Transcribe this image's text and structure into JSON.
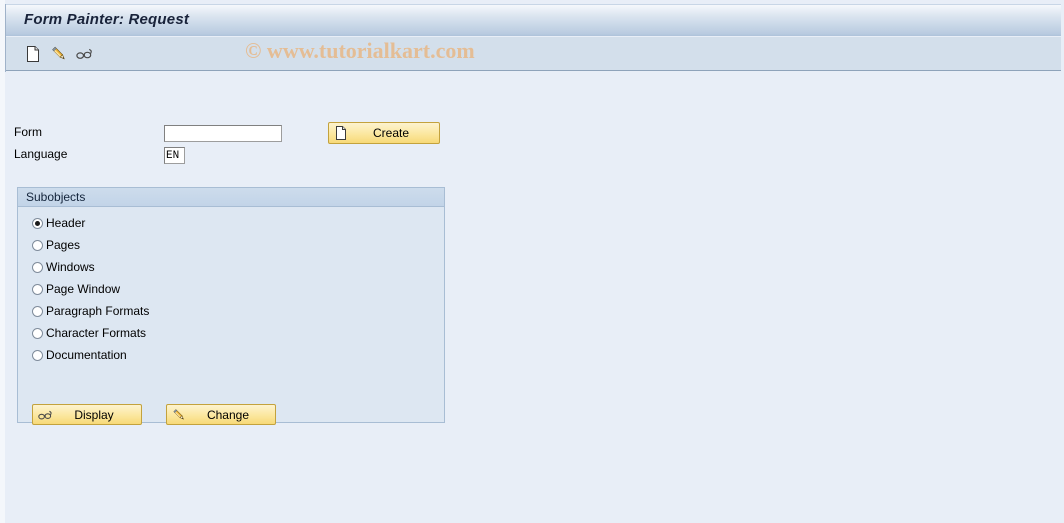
{
  "window": {
    "title": "Form Painter: Request"
  },
  "watermark": {
    "text": "© www.tutorialkart.com"
  },
  "toolbar": {
    "icons": [
      {
        "name": "create-icon",
        "glyph": "document"
      },
      {
        "name": "change-icon",
        "glyph": "pencil"
      },
      {
        "name": "display-icon",
        "glyph": "glasses"
      }
    ]
  },
  "selection": {
    "form": {
      "label": "Form",
      "value": "",
      "placeholder": ""
    },
    "language": {
      "label": "Language",
      "value": "EN",
      "placeholder": ""
    },
    "create_button": {
      "label": "Create",
      "icon": "document-icon"
    }
  },
  "subobjects": {
    "title": "Subobjects",
    "selected": "Header",
    "options": [
      {
        "label": "Header",
        "checked": true
      },
      {
        "label": "Pages",
        "checked": false
      },
      {
        "label": "Windows",
        "checked": false
      },
      {
        "label": "Page Window",
        "checked": false
      },
      {
        "label": "Paragraph Formats",
        "checked": false
      },
      {
        "label": "Character Formats",
        "checked": false
      },
      {
        "label": "Documentation",
        "checked": false
      }
    ],
    "actions": {
      "display": {
        "label": "Display",
        "icon": "glasses-icon"
      },
      "change": {
        "label": "Change",
        "icon": "pencil-icon"
      }
    }
  },
  "colors": {
    "titlebar_text": "#19233a",
    "toolbar_bg": "#d3dfeb",
    "page_bg": "#e8eef7",
    "group_bg": "#dde7f2",
    "button_yellow": "#fbe79f",
    "button_border": "#c3a23d",
    "watermark": "#e8b887"
  }
}
